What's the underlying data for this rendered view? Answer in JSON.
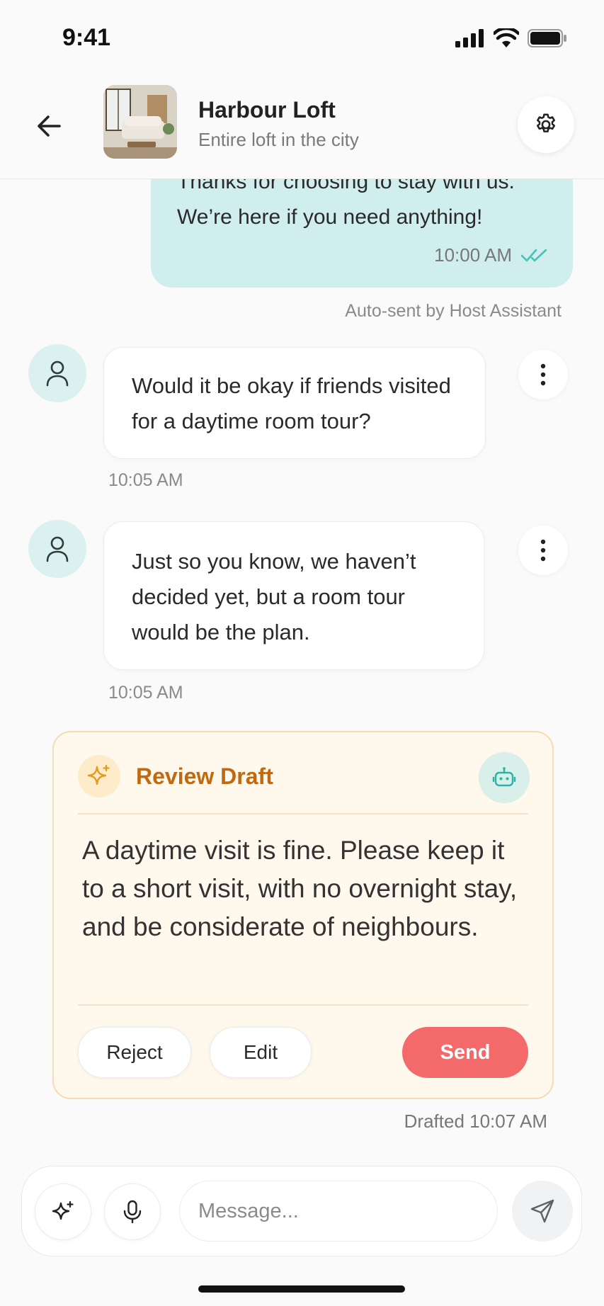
{
  "status_bar": {
    "time": "9:41"
  },
  "header": {
    "title": "Harbour Loft",
    "subtitle": "Entire loft in the city"
  },
  "messages": {
    "host": {
      "text": "Thanks for choosing to stay with us. We’re here if you need anything!",
      "time": "10:00 AM",
      "auto_sent_note": "Auto-sent by Host Assistant"
    },
    "guest": [
      {
        "text": "Would it be okay if friends visited for a daytime room tour?",
        "time": "10:05 AM"
      },
      {
        "text": "Just so you know, we haven’t decided yet, but a room tour would be the plan.",
        "time": "10:05 AM"
      }
    ]
  },
  "draft": {
    "title": "Review Draft",
    "text": "A daytime visit is fine. Please keep it to a short visit, with no overnight stay, and be considerate of neighbours.",
    "reject_label": "Reject",
    "edit_label": "Edit",
    "send_label": "Send",
    "drafted_time": "Drafted 10:07 AM"
  },
  "composer": {
    "placeholder": "Message..."
  },
  "colors": {
    "accent_teal": "#46c2b6",
    "host_bubble": "#cfeeed",
    "draft_title": "#bf6a10",
    "send_button": "#f46a6a"
  },
  "icons": {
    "back": "arrow-left-icon",
    "settings": "gear-icon",
    "read": "double-check-icon",
    "guest": "user-icon",
    "more": "vertical-dots-icon",
    "draft": "sparkle-icon",
    "assistant": "robot-icon",
    "mic": "microphone-icon",
    "send": "paper-plane-icon"
  }
}
